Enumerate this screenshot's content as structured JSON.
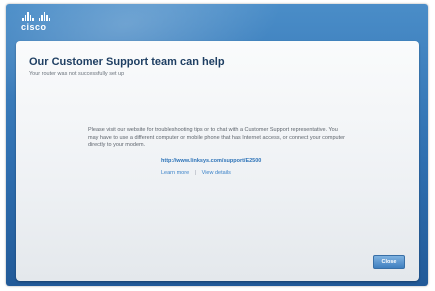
{
  "brand": {
    "logo_text": "cisco"
  },
  "header": {
    "title": "Our Customer Support team can help",
    "subtitle": "Your router was not successfully set up"
  },
  "message": {
    "body": "Please visit our website for troubleshooting tips or to chat with a Customer Support representative. You may have to use a different computer or mobile phone that has Internet access, or connect your computer directly to your modem.",
    "support_url": "http://www.linksys.com/support/E2500",
    "learn_more": "Learn more",
    "separator": "|",
    "view_details": "View details"
  },
  "footer": {
    "close_label": "Close"
  },
  "colors": {
    "frame_blue": "#2f6fb0",
    "title_navy": "#1f3f63",
    "link_blue": "#2d73b8"
  }
}
